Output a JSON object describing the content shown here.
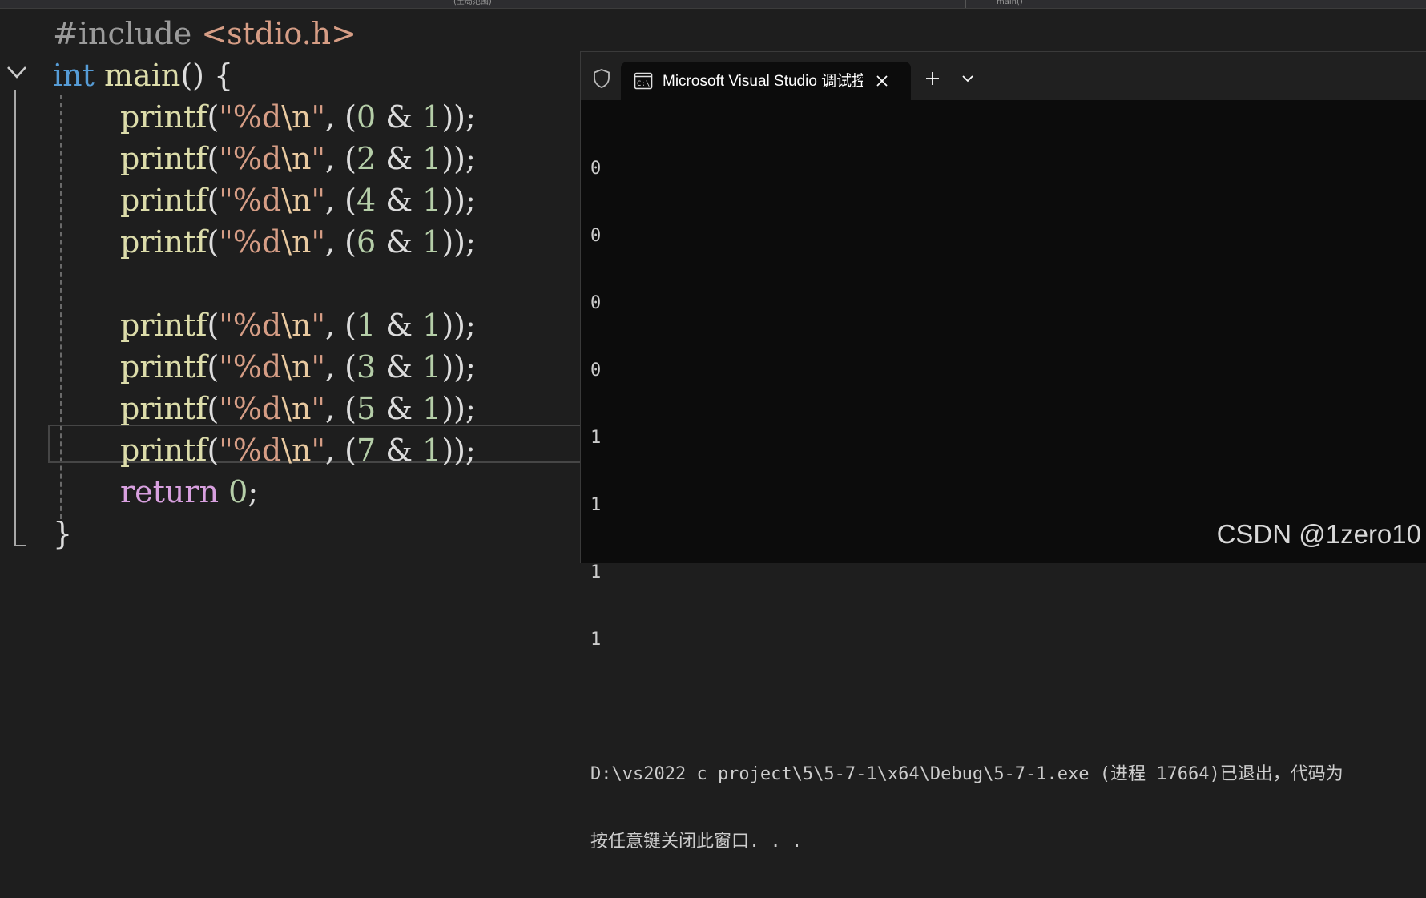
{
  "editor": {
    "topbar": {
      "seg2": "(全局范围)",
      "seg3": "main()"
    },
    "code": {
      "l1": {
        "pre": "#include",
        "inc": "<stdio.h>"
      },
      "l2": {
        "kw": "int",
        "fn": "main",
        "punc": "() {"
      },
      "printf_fn": "printf",
      "fmt": "\"%d",
      "esc": "\\n",
      "fmt_end": "\"",
      "lines": [
        {
          "n": "0",
          "m": "1"
        },
        {
          "n": "2",
          "m": "1"
        },
        {
          "n": "4",
          "m": "1"
        },
        {
          "n": "6",
          "m": "1"
        },
        {
          "n": "1",
          "m": "1"
        },
        {
          "n": "3",
          "m": "1"
        },
        {
          "n": "5",
          "m": "1"
        },
        {
          "n": "7",
          "m": "1"
        }
      ],
      "ret": {
        "kw": "return",
        "num": "0",
        "punc": ";"
      },
      "close": "}"
    }
  },
  "terminal": {
    "tab_title": "Microsoft Visual Studio 调试控制台",
    "output": [
      "0",
      "0",
      "0",
      "0",
      "1",
      "1",
      "1",
      "1"
    ],
    "exit_message": "D:\\vs2022 c project\\5\\5-7-1\\x64\\Debug\\5-7-1.exe (进程 17664)已退出，代码为",
    "press_key": "按任意键关闭此窗口. . ."
  },
  "watermark": "CSDN @1zero10",
  "colors": {
    "editor_bg": "#1e1e1e",
    "terminal_bg": "#0c0c0c",
    "keyword": "#569cd6",
    "function": "#dcdcaa",
    "string": "#d69d85",
    "number": "#b5cea8",
    "control": "#d8a0df"
  },
  "icons": [
    "fold-chevron-icon",
    "shield-icon",
    "cmd-icon",
    "close-icon",
    "plus-icon",
    "chevron-down-icon"
  ]
}
